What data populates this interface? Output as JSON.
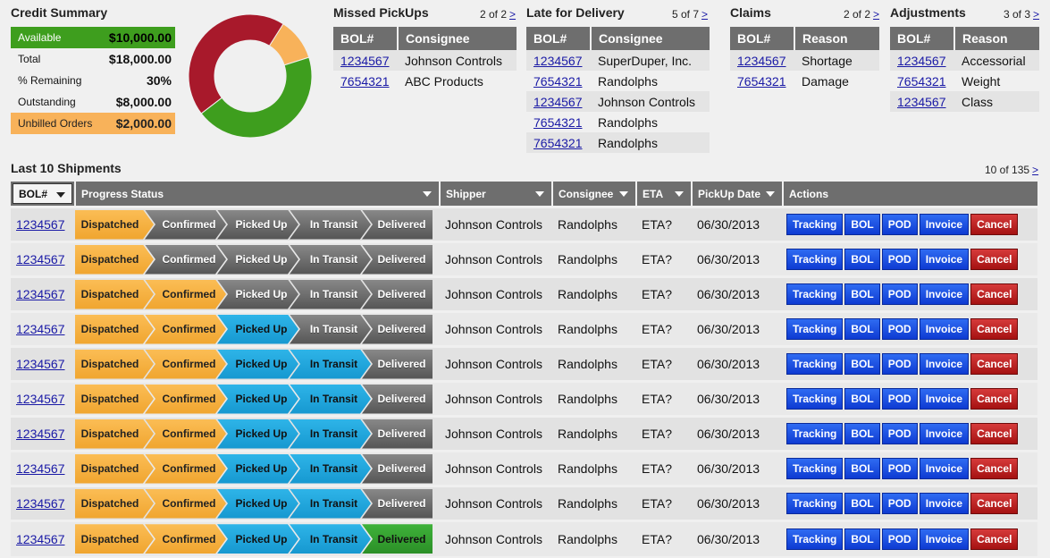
{
  "credit": {
    "title": "Credit Summary",
    "rows": [
      {
        "label": "Available",
        "value": "$10,000.00"
      },
      {
        "label": "Total",
        "value": "$18,000.00"
      },
      {
        "label": "% Remaining",
        "value": "30%"
      },
      {
        "label": "Outstanding",
        "value": "$8,000.00"
      },
      {
        "label": "Unbilled Orders",
        "value": "$2,000.00"
      }
    ],
    "donut": {
      "segments": [
        {
          "name": "Outstanding",
          "fraction": 0.444,
          "color": "#a8192b"
        },
        {
          "name": "Unbilled Orders",
          "fraction": 0.111,
          "color": "#f8b25a"
        },
        {
          "name": "Available",
          "fraction": 0.445,
          "color": "#3e9e1e"
        }
      ]
    }
  },
  "missed": {
    "title": "Missed PickUps",
    "pager": "2 of 2",
    "pager_arrow": ">",
    "headers": [
      "BOL#",
      "Consignee"
    ],
    "rows": [
      [
        "1234567",
        "Johnson Controls"
      ],
      [
        "7654321",
        "ABC Products"
      ]
    ]
  },
  "late": {
    "title": "Late for Delivery",
    "pager": "5 of 7",
    "pager_arrow": ">",
    "headers": [
      "BOL#",
      "Consignee"
    ],
    "rows": [
      [
        "1234567",
        "SuperDuper, Inc."
      ],
      [
        "7654321",
        "Randolphs"
      ],
      [
        "1234567",
        "Johnson Controls"
      ],
      [
        "7654321",
        "Randolphs"
      ],
      [
        "7654321",
        "Randolphs"
      ]
    ]
  },
  "claims": {
    "title": "Claims",
    "pager": "2 of 2",
    "pager_arrow": ">",
    "headers": [
      "BOL#",
      "Reason"
    ],
    "rows": [
      [
        "1234567",
        "Shortage"
      ],
      [
        "7654321",
        "Damage"
      ]
    ]
  },
  "adjust": {
    "title": "Adjustments",
    "pager": "3 of 3",
    "pager_arrow": ">",
    "headers": [
      "BOL#",
      "Reason"
    ],
    "rows": [
      [
        "1234567",
        "Accessorial"
      ],
      [
        "7654321",
        "Weight"
      ],
      [
        "1234567",
        "Class"
      ]
    ]
  },
  "shipments": {
    "title": "Last 10 Shipments",
    "pager": "10 of 135",
    "pager_arrow": ">",
    "headers": {
      "bol": "BOL#",
      "progress": "Progress Status",
      "shipper": "Shipper",
      "consignee": "Consignee",
      "eta": "ETA",
      "pickup": "PickUp Date",
      "actions": "Actions"
    },
    "stage_labels": [
      "Dispatched",
      "Confirmed",
      "Picked Up",
      "In Transit",
      "Delivered"
    ],
    "action_labels": [
      "Tracking",
      "BOL",
      "POD",
      "Invoice",
      "Cancel"
    ],
    "rows": [
      {
        "bol": "1234567",
        "stages_done": 1,
        "shipper": "Johnson Controls",
        "consignee": "Randolphs",
        "eta": "ETA?",
        "pickup": "06/30/2013"
      },
      {
        "bol": "1234567",
        "stages_done": 1,
        "shipper": "Johnson Controls",
        "consignee": "Randolphs",
        "eta": "ETA?",
        "pickup": "06/30/2013"
      },
      {
        "bol": "1234567",
        "stages_done": 2,
        "shipper": "Johnson Controls",
        "consignee": "Randolphs",
        "eta": "ETA?",
        "pickup": "06/30/2013"
      },
      {
        "bol": "1234567",
        "stages_done": 3,
        "shipper": "Johnson Controls",
        "consignee": "Randolphs",
        "eta": "ETA?",
        "pickup": "06/30/2013"
      },
      {
        "bol": "1234567",
        "stages_done": 4,
        "shipper": "Johnson Controls",
        "consignee": "Randolphs",
        "eta": "ETA?",
        "pickup": "06/30/2013"
      },
      {
        "bol": "1234567",
        "stages_done": 4,
        "shipper": "Johnson Controls",
        "consignee": "Randolphs",
        "eta": "ETA?",
        "pickup": "06/30/2013"
      },
      {
        "bol": "1234567",
        "stages_done": 4,
        "shipper": "Johnson Controls",
        "consignee": "Randolphs",
        "eta": "ETA?",
        "pickup": "06/30/2013"
      },
      {
        "bol": "1234567",
        "stages_done": 4,
        "shipper": "Johnson Controls",
        "consignee": "Randolphs",
        "eta": "ETA?",
        "pickup": "06/30/2013"
      },
      {
        "bol": "1234567",
        "stages_done": 4,
        "shipper": "Johnson Controls",
        "consignee": "Randolphs",
        "eta": "ETA?",
        "pickup": "06/30/2013"
      },
      {
        "bol": "1234567",
        "stages_done": 5,
        "shipper": "Johnson Controls",
        "consignee": "Randolphs",
        "eta": "ETA?",
        "pickup": "06/30/2013"
      }
    ]
  }
}
